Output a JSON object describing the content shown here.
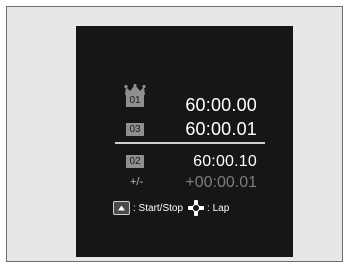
{
  "stopwatch": {
    "best_lap": {
      "number": "01",
      "time": "60:00.00"
    },
    "current_lap": {
      "number": "03",
      "time": "60:00.01"
    },
    "previous_lap": {
      "number": "02",
      "time": "60:00.10"
    },
    "difference": {
      "label": "+/-",
      "value": "+00:00.01"
    }
  },
  "legend": {
    "start_stop": ": Start/Stop",
    "lap": ": Lap"
  },
  "icons": {
    "crown": "crown-icon",
    "start_stop_button": "menu-button-icon",
    "lap_button": "four-way-selector-icon"
  },
  "colors": {
    "background": "#e7e7e7",
    "screen": "#161616",
    "text_primary": "#ffffff",
    "text_dim": "#7d7d7d",
    "badge": "#8f8f8f"
  }
}
